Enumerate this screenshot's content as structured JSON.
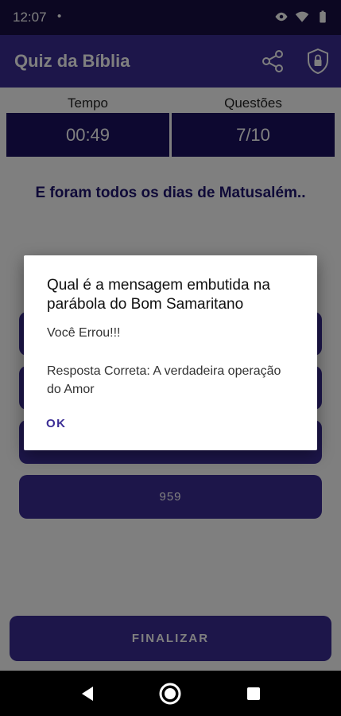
{
  "status_bar": {
    "time": "12:07",
    "dot": "•"
  },
  "app_bar": {
    "title": "Quiz da Bíblia"
  },
  "stats": {
    "time_label": "Tempo",
    "time_value": "00:49",
    "questions_label": "Questões",
    "questions_value": "7/10"
  },
  "question": {
    "text": "E foram todos os dias de Matusalém.."
  },
  "answers": [
    {
      "label": ""
    },
    {
      "label": ""
    },
    {
      "label": ""
    },
    {
      "label": "959"
    }
  ],
  "finish_label": "FINALIZAR",
  "dialog": {
    "title": "Qual é a mensagem embutida na parábola do Bom Samaritano",
    "message_line1": "Você Errou!!!",
    "message_line2": "Resposta Correta: A verdadeira operação do Amor",
    "ok_label": "OK"
  },
  "colors": {
    "primary": "#3b2d95",
    "primary_dark": "#1b1160",
    "status_bar": "#180e45"
  },
  "icons": {
    "share": "share-icon",
    "shield": "shield-lock-icon",
    "eye": "eye-icon",
    "wifi": "wifi-icon",
    "battery": "battery-icon",
    "back": "back-icon",
    "home": "home-icon",
    "recent": "recent-apps-icon"
  }
}
